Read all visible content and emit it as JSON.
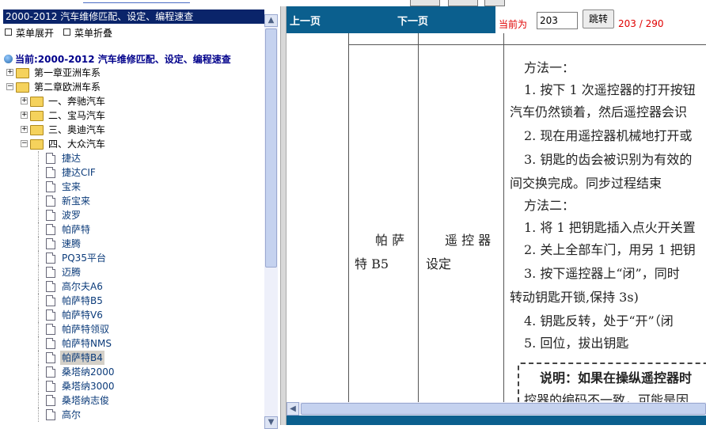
{
  "sidebar": {
    "title": "2000-2012 汽车维修匹配、设定、编程速查",
    "expand_label": "菜单展开",
    "collapse_label": "菜单折叠",
    "current_label": "当前:2000-2012 汽车维修匹配、设定、编程速查",
    "tree": [
      {
        "label": "第一章亚洲车系",
        "level": 0,
        "kind": "folder",
        "state": "+"
      },
      {
        "label": "第二章欧洲车系",
        "level": 0,
        "kind": "folder",
        "state": "-"
      },
      {
        "label": "一、奔驰汽车",
        "level": 1,
        "kind": "folder",
        "state": "+"
      },
      {
        "label": "二、宝马汽车",
        "level": 1,
        "kind": "folder",
        "state": "+"
      },
      {
        "label": "三、奥迪汽车",
        "level": 1,
        "kind": "folder",
        "state": "+"
      },
      {
        "label": "四、大众汽车",
        "level": 1,
        "kind": "folder",
        "state": "-"
      },
      {
        "label": "捷达",
        "level": 2,
        "kind": "doc"
      },
      {
        "label": "捷达CIF",
        "level": 2,
        "kind": "doc"
      },
      {
        "label": "宝来",
        "level": 2,
        "kind": "doc"
      },
      {
        "label": "新宝来",
        "level": 2,
        "kind": "doc"
      },
      {
        "label": "波罗",
        "level": 2,
        "kind": "doc"
      },
      {
        "label": "帕萨特",
        "level": 2,
        "kind": "doc"
      },
      {
        "label": "速腾",
        "level": 2,
        "kind": "doc"
      },
      {
        "label": "PQ35平台",
        "level": 2,
        "kind": "doc"
      },
      {
        "label": "迈腾",
        "level": 2,
        "kind": "doc"
      },
      {
        "label": "高尔夫A6",
        "level": 2,
        "kind": "doc"
      },
      {
        "label": "帕萨特B5",
        "level": 2,
        "kind": "doc"
      },
      {
        "label": "帕萨特V6",
        "level": 2,
        "kind": "doc"
      },
      {
        "label": "帕萨特领驭",
        "level": 2,
        "kind": "doc"
      },
      {
        "label": "帕萨特NMS",
        "level": 2,
        "kind": "doc"
      },
      {
        "label": "帕萨特B4",
        "level": 2,
        "kind": "doc",
        "selected": true
      },
      {
        "label": "桑塔纳2000",
        "level": 2,
        "kind": "doc"
      },
      {
        "label": "桑塔纳3000",
        "level": 2,
        "kind": "doc"
      },
      {
        "label": "桑塔纳志俊",
        "level": 2,
        "kind": "doc"
      },
      {
        "label": "高尔",
        "level": 2,
        "kind": "doc"
      }
    ]
  },
  "viewer": {
    "prev_label": "上一页",
    "next_label": "下一页",
    "current_page_label": "当前为",
    "page_input_value": "203",
    "go_label": "跳转",
    "page_count": "203 / 290"
  },
  "document": {
    "header_col1": "",
    "header_col2": "",
    "model_line1": "帕 萨",
    "model_line2": "特 B5",
    "item_line1": "遥 控 器",
    "item_line2": "设定",
    "lines": [
      "方法一：",
      "1. 按下 1 次遥控器的打开按钮",
      "汽车仍然锁着，然后遥控器会识",
      "2. 现在用遥控器机械地打开或",
      "3. 钥匙的齿会被识别为有效的",
      "间交换完成。同步过程结束",
      "方法二：",
      "1. 将 1 把钥匙插入点火开关置",
      "2. 关上全部车门，用另 1 把钥",
      "3. 按下遥控器上“闭”，同时",
      "转动钥匙开锁,保持 3s)",
      "4. 钥匙反转，处于“开”（闭",
      "5. 回位，拔出钥匙"
    ],
    "note_line1": "说明：如果在操纵遥控器时",
    "note_line2": "控器的编码不一致，可能是因"
  }
}
